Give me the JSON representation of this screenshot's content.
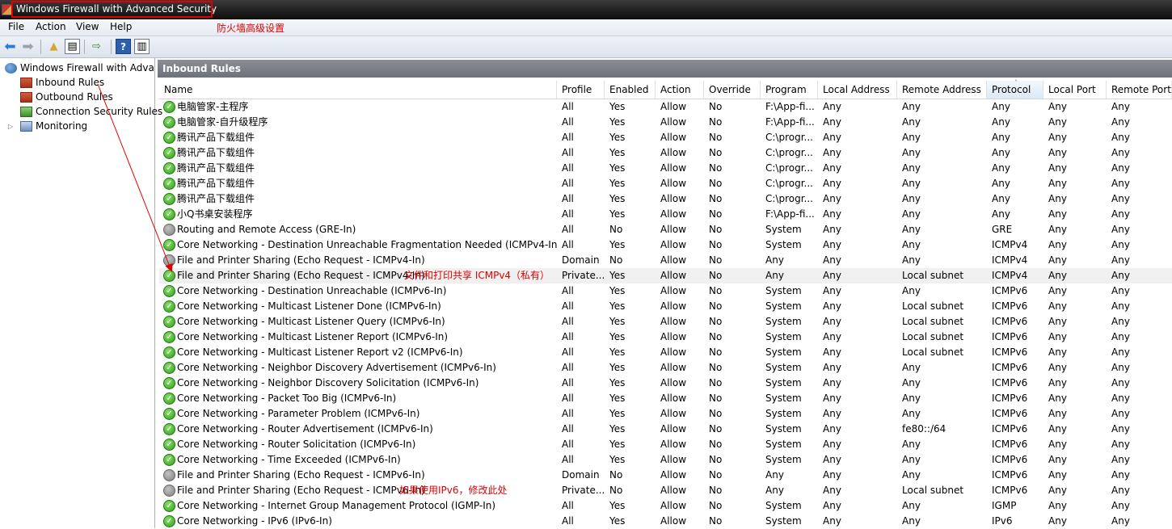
{
  "window": {
    "title": "Windows Firewall with Advanced Security"
  },
  "annotations": {
    "title_note": "防火墙高级设置",
    "echo_v4_note": "文件和打印共享 ICMPv4（私有）",
    "echo_v6_note": "如果使用IPv6，修改此处"
  },
  "menu": {
    "file": "File",
    "action": "Action",
    "view": "View",
    "help": "Help"
  },
  "toolbar": {
    "back_icon": "back-arrow-icon",
    "forward_icon": "forward-arrow-icon",
    "help_label": "?"
  },
  "tree": {
    "root": "Windows Firewall with Advanced Security",
    "inbound": "Inbound Rules",
    "outbound": "Outbound Rules",
    "connection": "Connection Security Rules",
    "monitoring": "Monitoring"
  },
  "panel": {
    "title": "Inbound Rules"
  },
  "columns": [
    "Name",
    "Profile",
    "Enabled",
    "Action",
    "Override",
    "Program",
    "Local Address",
    "Remote Address",
    "Protocol",
    "Local Port",
    "Remote Port"
  ],
  "colors": {
    "annotation": "#e00000",
    "enabled": "#2f9a1b",
    "disabled": "#7d7d7d"
  },
  "rules": [
    {
      "on": true,
      "name": "电脑管家-主程序",
      "profile": "All",
      "enabled": "Yes",
      "action": "Allow",
      "override": "No",
      "program": "F:\\App-fi...",
      "local": "Any",
      "remote": "Any",
      "protocol": "Any",
      "lport": "Any",
      "rport": "Any"
    },
    {
      "on": true,
      "name": "电脑管家-自升级程序",
      "profile": "All",
      "enabled": "Yes",
      "action": "Allow",
      "override": "No",
      "program": "F:\\App-fi...",
      "local": "Any",
      "remote": "Any",
      "protocol": "Any",
      "lport": "Any",
      "rport": "Any"
    },
    {
      "on": true,
      "name": "腾讯产品下载组件",
      "profile": "All",
      "enabled": "Yes",
      "action": "Allow",
      "override": "No",
      "program": "C:\\progr...",
      "local": "Any",
      "remote": "Any",
      "protocol": "Any",
      "lport": "Any",
      "rport": "Any"
    },
    {
      "on": true,
      "name": "腾讯产品下载组件",
      "profile": "All",
      "enabled": "Yes",
      "action": "Allow",
      "override": "No",
      "program": "C:\\progr...",
      "local": "Any",
      "remote": "Any",
      "protocol": "Any",
      "lport": "Any",
      "rport": "Any"
    },
    {
      "on": true,
      "name": "腾讯产品下载组件",
      "profile": "All",
      "enabled": "Yes",
      "action": "Allow",
      "override": "No",
      "program": "C:\\progr...",
      "local": "Any",
      "remote": "Any",
      "protocol": "Any",
      "lport": "Any",
      "rport": "Any"
    },
    {
      "on": true,
      "name": "腾讯产品下载组件",
      "profile": "All",
      "enabled": "Yes",
      "action": "Allow",
      "override": "No",
      "program": "C:\\progr...",
      "local": "Any",
      "remote": "Any",
      "protocol": "Any",
      "lport": "Any",
      "rport": "Any"
    },
    {
      "on": true,
      "name": "腾讯产品下载组件",
      "profile": "All",
      "enabled": "Yes",
      "action": "Allow",
      "override": "No",
      "program": "C:\\progr...",
      "local": "Any",
      "remote": "Any",
      "protocol": "Any",
      "lport": "Any",
      "rport": "Any"
    },
    {
      "on": true,
      "name": "小Q书桌安装程序",
      "profile": "All",
      "enabled": "Yes",
      "action": "Allow",
      "override": "No",
      "program": "F:\\App-fi...",
      "local": "Any",
      "remote": "Any",
      "protocol": "Any",
      "lport": "Any",
      "rport": "Any"
    },
    {
      "on": false,
      "name": "Routing and Remote Access (GRE-In)",
      "profile": "All",
      "enabled": "No",
      "action": "Allow",
      "override": "No",
      "program": "System",
      "local": "Any",
      "remote": "Any",
      "protocol": "GRE",
      "lport": "Any",
      "rport": "Any"
    },
    {
      "on": true,
      "name": "Core Networking - Destination Unreachable Fragmentation Needed (ICMPv4-In)",
      "profile": "All",
      "enabled": "Yes",
      "action": "Allow",
      "override": "No",
      "program": "System",
      "local": "Any",
      "remote": "Any",
      "protocol": "ICMPv4",
      "lport": "Any",
      "rport": "Any"
    },
    {
      "on": false,
      "name": "File and Printer Sharing (Echo Request - ICMPv4-In)",
      "profile": "Domain",
      "enabled": "No",
      "action": "Allow",
      "override": "No",
      "program": "Any",
      "local": "Any",
      "remote": "Any",
      "protocol": "ICMPv4",
      "lport": "Any",
      "rport": "Any"
    },
    {
      "on": true,
      "name": "File and Printer Sharing (Echo Request - ICMPv4-In)",
      "profile": "Private...",
      "enabled": "Yes",
      "action": "Allow",
      "override": "No",
      "program": "Any",
      "local": "Any",
      "remote": "Local subnet",
      "protocol": "ICMPv4",
      "lport": "Any",
      "rport": "Any",
      "hl": true,
      "note": "echo_v4_note"
    },
    {
      "on": true,
      "name": "Core Networking - Destination Unreachable (ICMPv6-In)",
      "profile": "All",
      "enabled": "Yes",
      "action": "Allow",
      "override": "No",
      "program": "System",
      "local": "Any",
      "remote": "Any",
      "protocol": "ICMPv6",
      "lport": "Any",
      "rport": "Any"
    },
    {
      "on": true,
      "name": "Core Networking - Multicast Listener Done (ICMPv6-In)",
      "profile": "All",
      "enabled": "Yes",
      "action": "Allow",
      "override": "No",
      "program": "System",
      "local": "Any",
      "remote": "Local subnet",
      "protocol": "ICMPv6",
      "lport": "Any",
      "rport": "Any"
    },
    {
      "on": true,
      "name": "Core Networking - Multicast Listener Query (ICMPv6-In)",
      "profile": "All",
      "enabled": "Yes",
      "action": "Allow",
      "override": "No",
      "program": "System",
      "local": "Any",
      "remote": "Local subnet",
      "protocol": "ICMPv6",
      "lport": "Any",
      "rport": "Any"
    },
    {
      "on": true,
      "name": "Core Networking - Multicast Listener Report (ICMPv6-In)",
      "profile": "All",
      "enabled": "Yes",
      "action": "Allow",
      "override": "No",
      "program": "System",
      "local": "Any",
      "remote": "Local subnet",
      "protocol": "ICMPv6",
      "lport": "Any",
      "rport": "Any"
    },
    {
      "on": true,
      "name": "Core Networking - Multicast Listener Report v2 (ICMPv6-In)",
      "profile": "All",
      "enabled": "Yes",
      "action": "Allow",
      "override": "No",
      "program": "System",
      "local": "Any",
      "remote": "Local subnet",
      "protocol": "ICMPv6",
      "lport": "Any",
      "rport": "Any"
    },
    {
      "on": true,
      "name": "Core Networking - Neighbor Discovery Advertisement (ICMPv6-In)",
      "profile": "All",
      "enabled": "Yes",
      "action": "Allow",
      "override": "No",
      "program": "System",
      "local": "Any",
      "remote": "Any",
      "protocol": "ICMPv6",
      "lport": "Any",
      "rport": "Any"
    },
    {
      "on": true,
      "name": "Core Networking - Neighbor Discovery Solicitation (ICMPv6-In)",
      "profile": "All",
      "enabled": "Yes",
      "action": "Allow",
      "override": "No",
      "program": "System",
      "local": "Any",
      "remote": "Any",
      "protocol": "ICMPv6",
      "lport": "Any",
      "rport": "Any"
    },
    {
      "on": true,
      "name": "Core Networking - Packet Too Big (ICMPv6-In)",
      "profile": "All",
      "enabled": "Yes",
      "action": "Allow",
      "override": "No",
      "program": "System",
      "local": "Any",
      "remote": "Any",
      "protocol": "ICMPv6",
      "lport": "Any",
      "rport": "Any"
    },
    {
      "on": true,
      "name": "Core Networking - Parameter Problem (ICMPv6-In)",
      "profile": "All",
      "enabled": "Yes",
      "action": "Allow",
      "override": "No",
      "program": "System",
      "local": "Any",
      "remote": "Any",
      "protocol": "ICMPv6",
      "lport": "Any",
      "rport": "Any"
    },
    {
      "on": true,
      "name": "Core Networking - Router Advertisement (ICMPv6-In)",
      "profile": "All",
      "enabled": "Yes",
      "action": "Allow",
      "override": "No",
      "program": "System",
      "local": "Any",
      "remote": "fe80::/64",
      "protocol": "ICMPv6",
      "lport": "Any",
      "rport": "Any"
    },
    {
      "on": true,
      "name": "Core Networking - Router Solicitation (ICMPv6-In)",
      "profile": "All",
      "enabled": "Yes",
      "action": "Allow",
      "override": "No",
      "program": "System",
      "local": "Any",
      "remote": "Any",
      "protocol": "ICMPv6",
      "lport": "Any",
      "rport": "Any"
    },
    {
      "on": true,
      "name": "Core Networking - Time Exceeded (ICMPv6-In)",
      "profile": "All",
      "enabled": "Yes",
      "action": "Allow",
      "override": "No",
      "program": "System",
      "local": "Any",
      "remote": "Any",
      "protocol": "ICMPv6",
      "lport": "Any",
      "rport": "Any"
    },
    {
      "on": false,
      "name": "File and Printer Sharing (Echo Request - ICMPv6-In)",
      "profile": "Domain",
      "enabled": "No",
      "action": "Allow",
      "override": "No",
      "program": "Any",
      "local": "Any",
      "remote": "Any",
      "protocol": "ICMPv6",
      "lport": "Any",
      "rport": "Any"
    },
    {
      "on": false,
      "name": "File and Printer Sharing (Echo Request - ICMPv6-In)",
      "profile": "Private...",
      "enabled": "No",
      "action": "Allow",
      "override": "No",
      "program": "Any",
      "local": "Any",
      "remote": "Local subnet",
      "protocol": "ICMPv6",
      "lport": "Any",
      "rport": "Any",
      "note": "echo_v6_note"
    },
    {
      "on": true,
      "name": "Core Networking - Internet Group Management Protocol (IGMP-In)",
      "profile": "All",
      "enabled": "Yes",
      "action": "Allow",
      "override": "No",
      "program": "System",
      "local": "Any",
      "remote": "Any",
      "protocol": "IGMP",
      "lport": "Any",
      "rport": "Any"
    },
    {
      "on": true,
      "name": "Core Networking - IPv6 (IPv6-In)",
      "profile": "All",
      "enabled": "Yes",
      "action": "Allow",
      "override": "No",
      "program": "System",
      "local": "Any",
      "remote": "Any",
      "protocol": "IPv6",
      "lport": "Any",
      "rport": "Any"
    }
  ]
}
